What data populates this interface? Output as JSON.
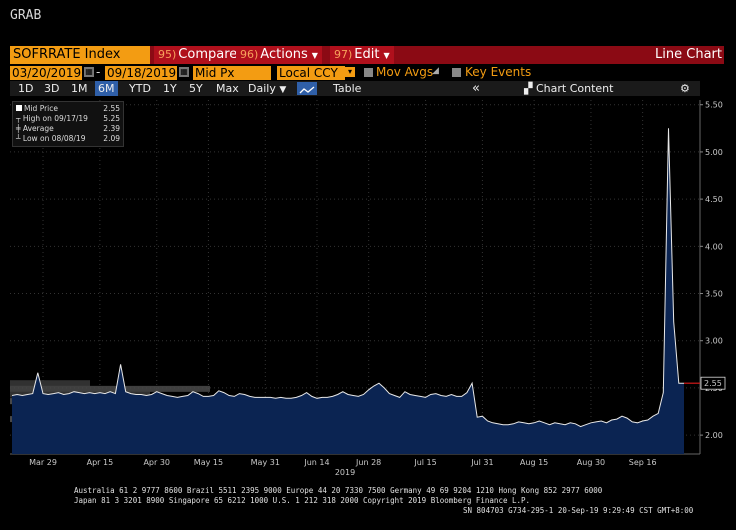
{
  "app": {
    "title": "GRAB"
  },
  "header": {
    "ticker": "SOFRRATE Index",
    "menus": [
      {
        "num": "95)",
        "label": "Compare"
      },
      {
        "num": "96)",
        "label": "Actions"
      },
      {
        "num": "97)",
        "label": "Edit"
      }
    ],
    "chart_type_label": "Line Chart"
  },
  "controls": {
    "start_date": "03/20/2019",
    "end_date": "09/18/2019",
    "date_sep": "-",
    "field": "Mid Px",
    "currency": "Local CCY",
    "mov_avgs": "Mov Avgs",
    "key_events": "Key Events"
  },
  "toolbar": {
    "periods": [
      "1D",
      "3D",
      "1M",
      "6M",
      "YTD",
      "1Y",
      "5Y",
      "Max"
    ],
    "selected_period": "6M",
    "frequency": "Daily",
    "table_label": "Table",
    "collapse": "«",
    "chart_content": "Chart Content"
  },
  "legend": {
    "rows": [
      {
        "label": "Mid Price",
        "value": "2.55"
      },
      {
        "label": "High on 09/17/19",
        "value": "5.25"
      },
      {
        "label": "Average",
        "value": "2.39"
      },
      {
        "label": "Low on 08/08/19",
        "value": "2.09"
      }
    ]
  },
  "chart_data": {
    "type": "area",
    "series": [
      {
        "values": [
          2.42,
          2.43,
          2.42,
          2.43,
          2.44,
          2.66,
          2.44,
          2.43,
          2.44,
          2.45,
          2.43,
          2.44,
          2.46,
          2.45,
          2.44,
          2.45,
          2.44,
          2.45,
          2.44,
          2.46,
          2.44,
          2.75,
          2.46,
          2.44,
          2.43,
          2.43,
          2.42,
          2.43,
          2.46,
          2.44,
          2.42,
          2.41,
          2.4,
          2.41,
          2.42,
          2.46,
          2.44,
          2.41,
          2.41,
          2.42,
          2.47,
          2.45,
          2.42,
          2.41,
          2.44,
          2.43,
          2.41,
          2.4,
          2.4,
          2.4,
          2.4,
          2.39,
          2.4,
          2.39,
          2.39,
          2.4,
          2.42,
          2.45,
          2.41,
          2.39,
          2.4,
          2.4,
          2.41,
          2.43,
          2.46,
          2.43,
          2.42,
          2.41,
          2.43,
          2.48,
          2.52,
          2.55,
          2.5,
          2.44,
          2.42,
          2.4,
          2.46,
          2.43,
          2.42,
          2.41,
          2.4,
          2.43,
          2.44,
          2.42,
          2.41,
          2.43,
          2.41,
          2.41,
          2.45,
          2.55,
          2.19,
          2.2,
          2.15,
          2.13,
          2.12,
          2.11,
          2.11,
          2.12,
          2.14,
          2.13,
          2.12,
          2.13,
          2.15,
          2.13,
          2.11,
          2.13,
          2.12,
          2.11,
          2.13,
          2.12,
          2.09,
          2.11,
          2.13,
          2.14,
          2.15,
          2.13,
          2.16,
          2.17,
          2.2,
          2.18,
          2.14,
          2.13,
          2.15,
          2.16,
          2.2,
          2.23,
          2.45,
          5.25,
          3.2,
          2.55,
          2.55
        ]
      }
    ],
    "ylim": [
      1.8,
      5.55
    ],
    "y_ticks": [
      2.0,
      2.5,
      3.0,
      3.5,
      4.0,
      4.5,
      5.0,
      5.5
    ],
    "y_tick_labels": [
      "2.00",
      "2.50",
      "3.00",
      "3.50",
      "4.00",
      "4.50",
      "5.00",
      "5.50"
    ],
    "x_tick_labels": [
      "Mar 29",
      "Apr 15",
      "Apr 30",
      "May 15",
      "May 31",
      "Jun 14",
      "Jun 28",
      "Jul 15",
      "Jul 31",
      "Aug 15",
      "Aug 30",
      "Sep 16"
    ],
    "x_tick_index": [
      6,
      17,
      28,
      38,
      49,
      59,
      69,
      80,
      91,
      101,
      112,
      122
    ],
    "xlabel": "2019",
    "last_value_label": "2.55",
    "grid": true,
    "colors": {
      "line": "#e8e8e8",
      "fill": "#0b2452",
      "grid": "#333333",
      "last_marker": "#d11a1a"
    }
  },
  "footer": {
    "line1": "Australia 61 2 9777 8600 Brazil 5511 2395 9000 Europe 44 20 7330 7500 Germany 49 69 9204 1210 Hong Kong 852 2977 6000",
    "line2": "Japan 81 3 3201 8900          Singapore 65 6212 1000        U.S. 1 212 318 2000          Copyright 2019 Bloomberg Finance L.P.",
    "line3": "SN 804703 G734-295-1 20-Sep-19  9:29:49 CST  GMT+8:00"
  }
}
